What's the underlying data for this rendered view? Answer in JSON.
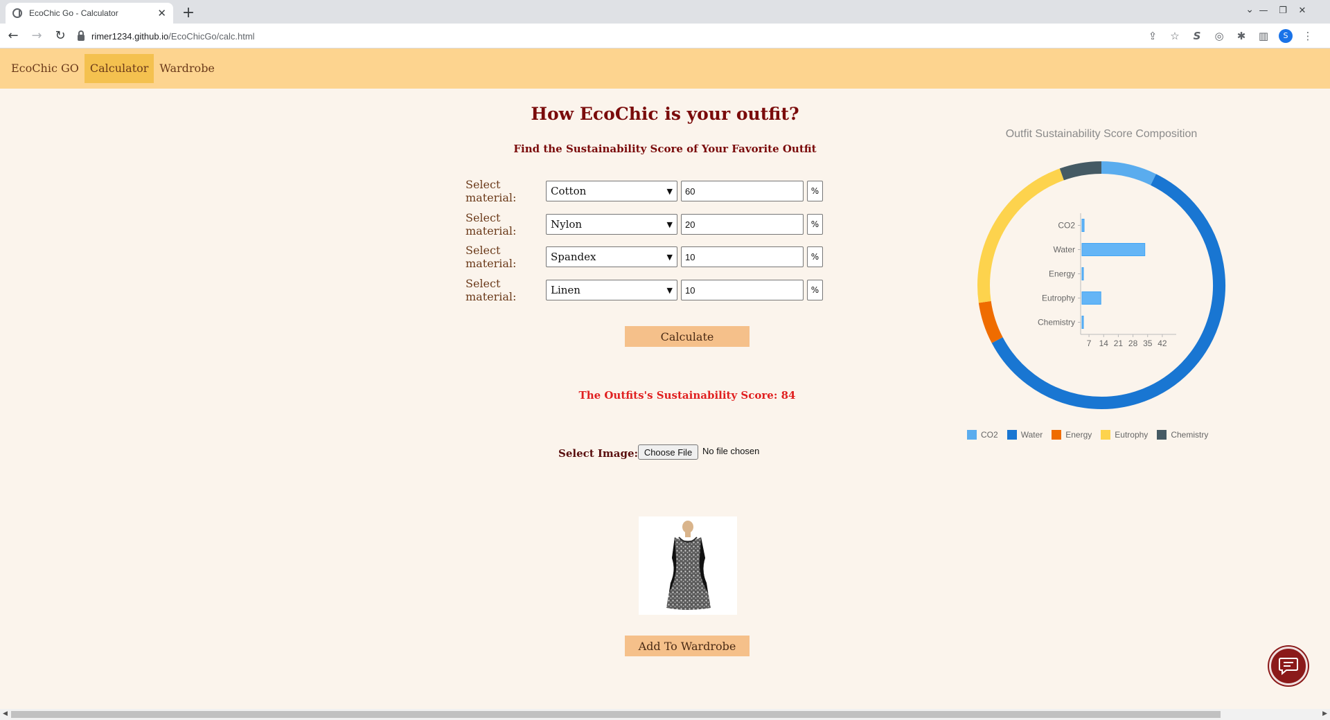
{
  "browser": {
    "tab_title": "EcoChic Go - Calculator",
    "new_tab": "+",
    "close_tab": "✕",
    "url_host": "rimer1234.github.io",
    "url_path": "/EcoChicGo/calc.html",
    "profile_initial": "S"
  },
  "nav": {
    "brand": "EcoChic GO",
    "items": [
      {
        "label": "Calculator",
        "active": true
      },
      {
        "label": "Wardrobe",
        "active": false
      }
    ]
  },
  "calculator": {
    "title": "How EcoChic is your outfit?",
    "subtitle": "Find the Sustainability Score of Your Favorite Outfit",
    "rows": [
      {
        "label": "Select material:",
        "material": "Cotton",
        "percent": "60",
        "unit": "%"
      },
      {
        "label": "Select material:",
        "material": "Nylon",
        "percent": "20",
        "unit": "%"
      },
      {
        "label": "Select material:",
        "material": "Spandex",
        "percent": "10",
        "unit": "%"
      },
      {
        "label": "Select material:",
        "material": "Linen",
        "percent": "10",
        "unit": "%"
      }
    ],
    "calculate_label": "Calculate",
    "score_text": "The Outfits's Sustainability Score: 84",
    "image_label": "Select Image:",
    "choose_file_label": "Choose File",
    "no_file_text": "No file chosen",
    "add_label": "Add To Wardrobe"
  },
  "chart_data": {
    "type": "bar",
    "title": "Outfit Sustainability Score Composition",
    "categories": [
      "CO2",
      "Water",
      "Energy",
      "Eutrophy",
      "Chemistry"
    ],
    "values": [
      4,
      33,
      3,
      12,
      3
    ],
    "orientation": "horizontal",
    "xticks": [
      "7",
      "14",
      "21",
      "28",
      "35",
      "42"
    ],
    "xlim": [
      3,
      46
    ],
    "bar_color": "#64b5f6",
    "ring": {
      "type": "pie",
      "categories": [
        "CO2",
        "Water",
        "Energy",
        "Eutrophy",
        "Chemistry"
      ],
      "values": [
        4,
        33,
        3,
        12,
        3
      ],
      "colors": [
        "#5aacee",
        "#1976d2",
        "#ef6c00",
        "#fdd34d",
        "#455a64"
      ]
    },
    "legend": [
      {
        "name": "CO2",
        "color": "#5aacee"
      },
      {
        "name": "Water",
        "color": "#1976d2"
      },
      {
        "name": "Energy",
        "color": "#ef6c00"
      },
      {
        "name": "Eutrophy",
        "color": "#fdd34d"
      },
      {
        "name": "Chemistry",
        "color": "#455a64"
      }
    ],
    "legend_position": "bottom"
  }
}
